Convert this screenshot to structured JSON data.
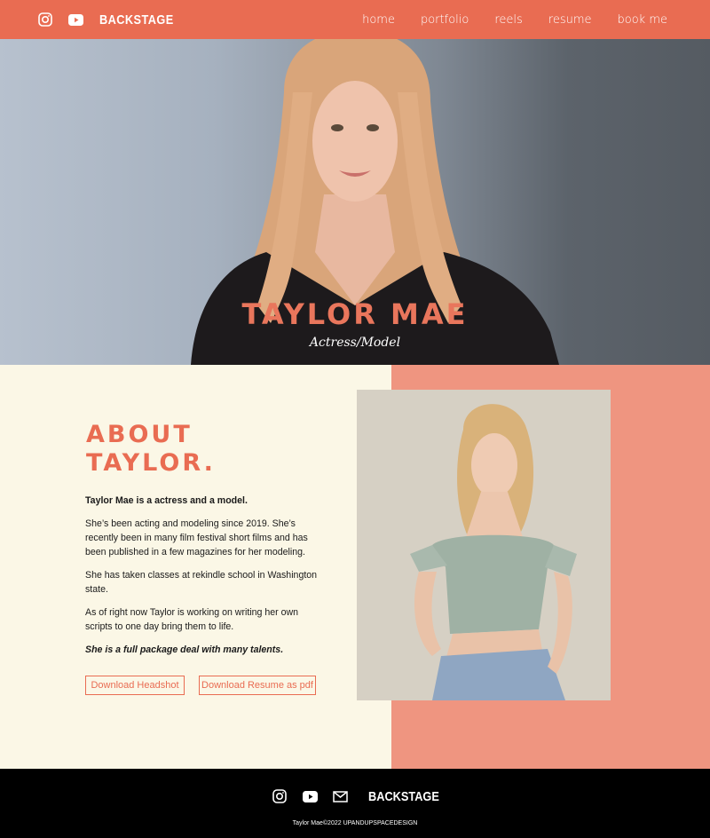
{
  "header": {
    "brand": "BACKSTAGE",
    "social_icons": [
      "instagram-icon",
      "youtube-icon"
    ],
    "nav": [
      "home",
      "portfolio",
      "reels",
      "resume",
      "book me"
    ]
  },
  "hero": {
    "name": "TAYLOR MAE",
    "role": "Actress/Model"
  },
  "about": {
    "heading_line1": "ABOUT",
    "heading_line2": "TAYLOR.",
    "lead": "Taylor Mae is a actress and a model.",
    "paragraphs": [
      "She’s been acting and modeling since 2019. She’s recently been in many film festival short films and has been published in a few magazines for her modeling.",
      "She has taken classes at rekindle school in Washington state.",
      "As of right now Taylor is working on writing her own scripts to one day bring them to life."
    ],
    "closing": "She is a full package deal with many talents.",
    "buttons": {
      "headshot": "Download Headshot",
      "resume": "Download Resume as pdf"
    }
  },
  "footer": {
    "brand": "BACKSTAGE",
    "icons": [
      "instagram-icon",
      "youtube-icon",
      "mail-icon"
    ],
    "copyright": "Taylor Mae©2022 UPANDUPSPACEDESIGN"
  },
  "colors": {
    "accent": "#e96c52",
    "salmon": "#ef9580",
    "cream": "#fbf7e6",
    "footer": "#000000"
  }
}
